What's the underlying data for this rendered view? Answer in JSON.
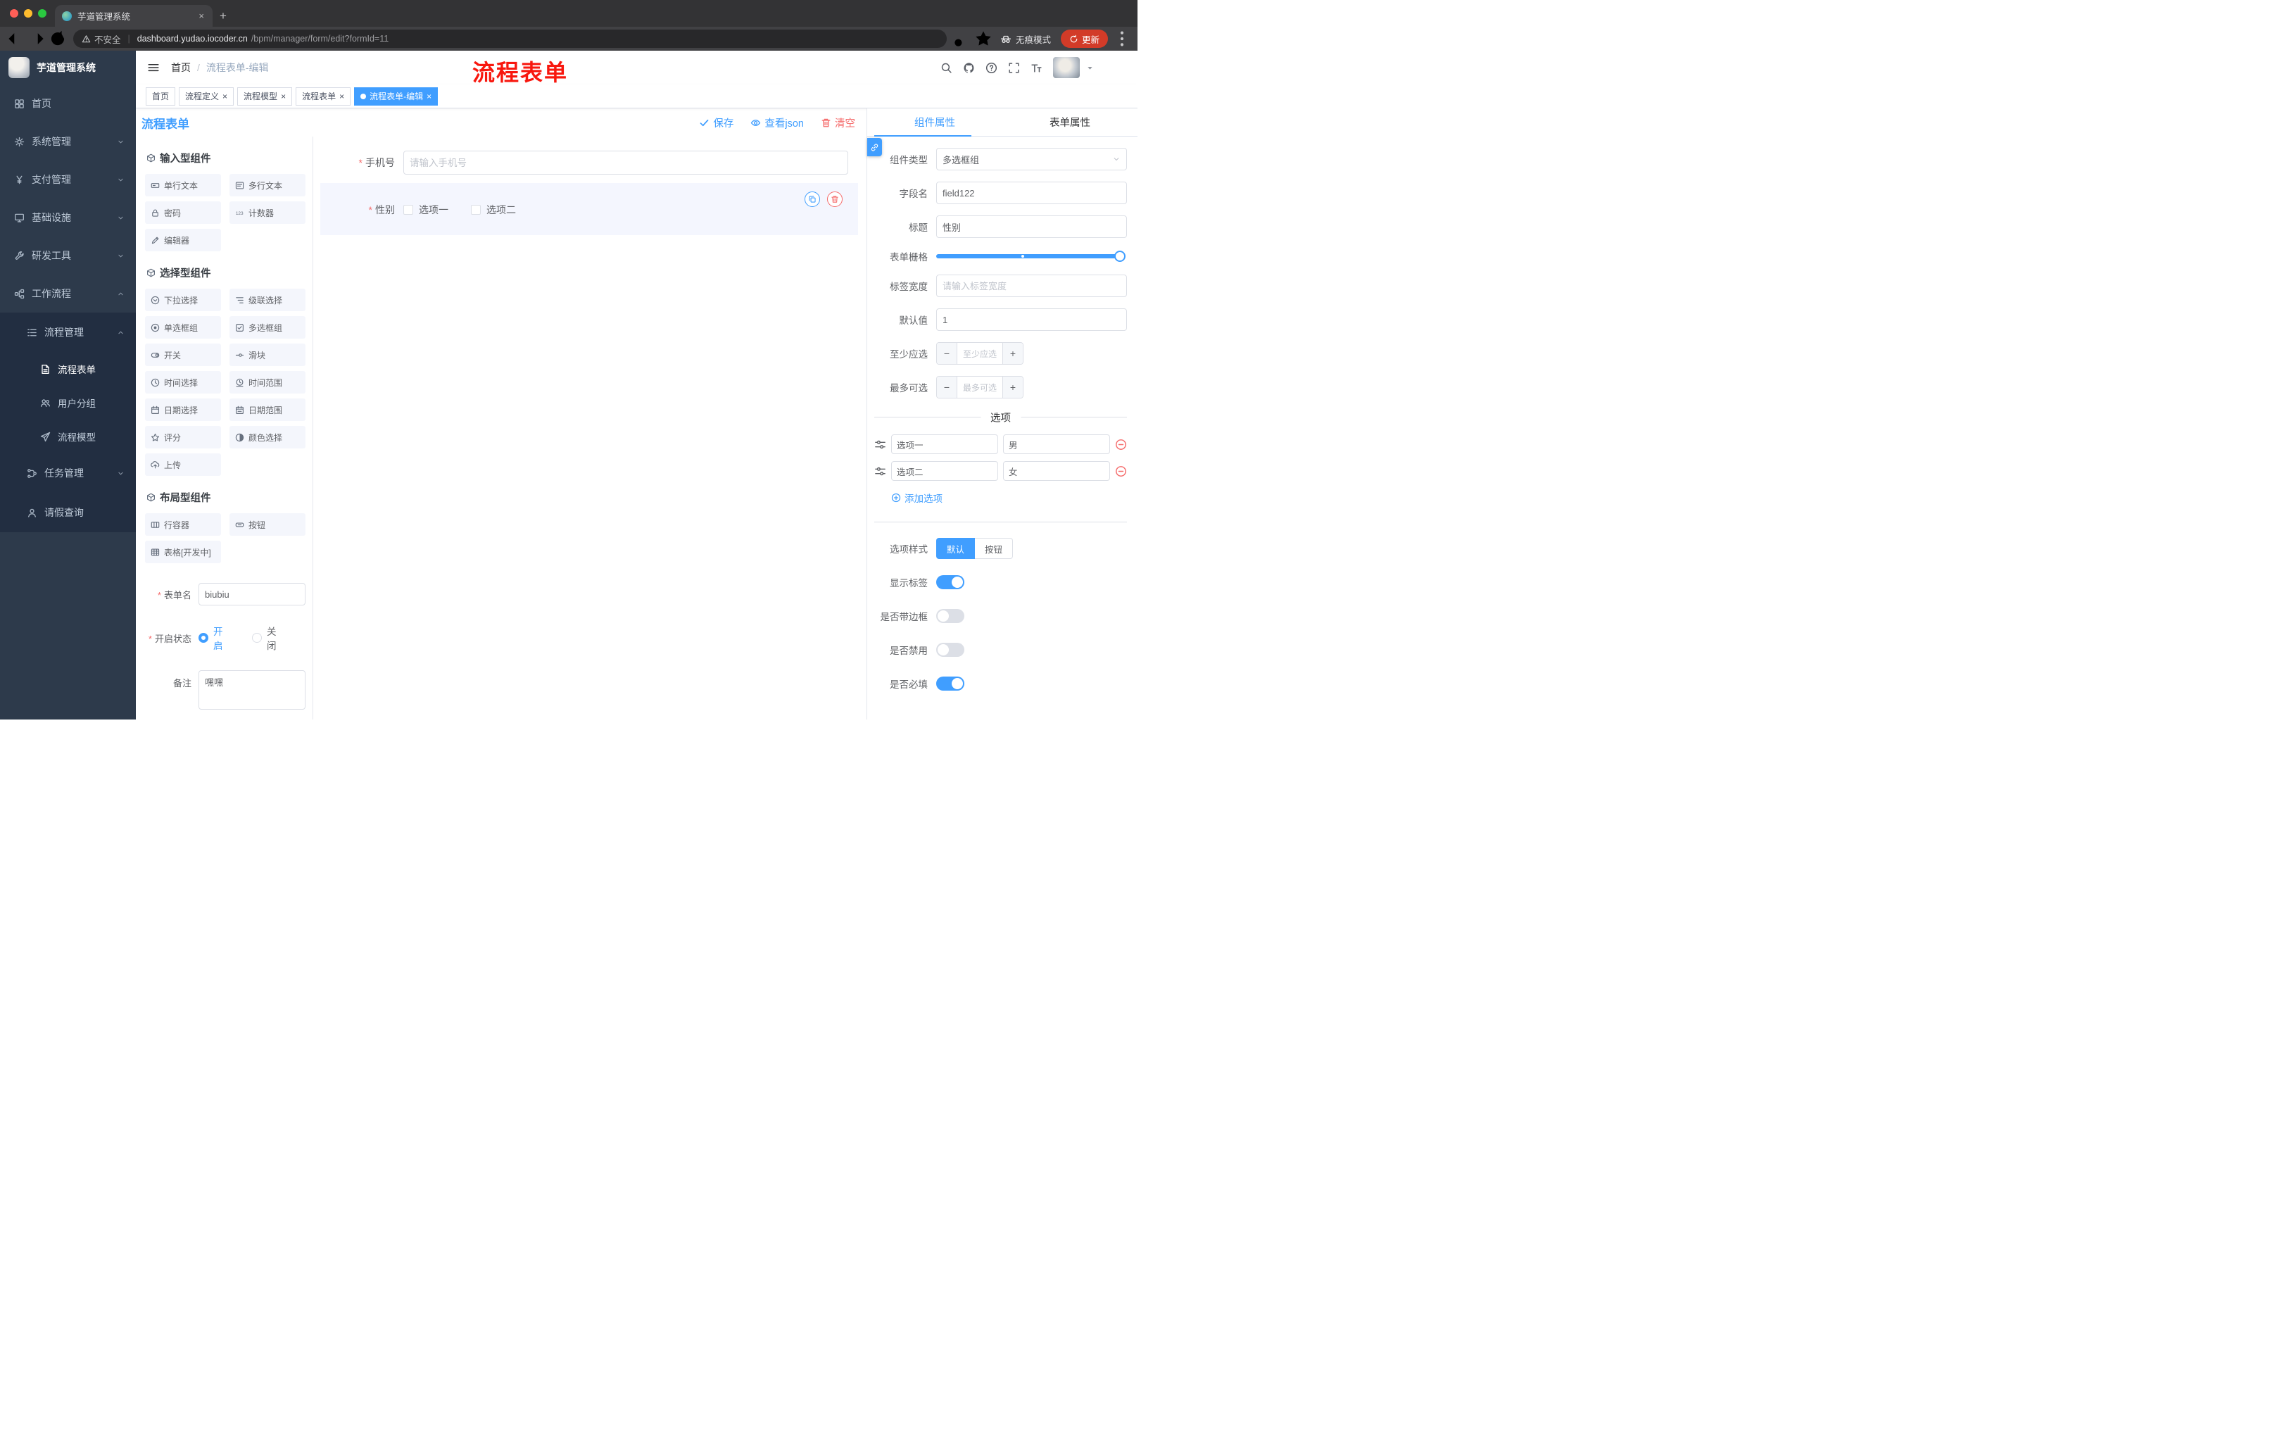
{
  "browser": {
    "tab_title": "芋道管理系统",
    "security_label": "不安全",
    "url_host": "dashboard.yudao.iocoder.cn",
    "url_path": "/bpm/manager/form/edit?formId=11",
    "incognito_label": "无痕模式",
    "update_label": "更新"
  },
  "sidebar": {
    "logo_title": "芋道管理系统",
    "items": [
      {
        "id": "home",
        "label": "首页",
        "icon": "dashboard",
        "level": 0
      },
      {
        "id": "system",
        "label": "系统管理",
        "icon": "gear",
        "level": 0,
        "chevron": "down"
      },
      {
        "id": "payment",
        "label": "支付管理",
        "icon": "yen",
        "level": 0,
        "chevron": "down"
      },
      {
        "id": "infra",
        "label": "基础设施",
        "icon": "monitor",
        "level": 0,
        "chevron": "down"
      },
      {
        "id": "devtools",
        "label": "研发工具",
        "icon": "wrench",
        "level": 0,
        "chevron": "down"
      },
      {
        "id": "workflow",
        "label": "工作流程",
        "icon": "workflow",
        "level": 0,
        "chevron": "up"
      },
      {
        "id": "process-management",
        "label": "流程管理",
        "icon": "list",
        "level": 1,
        "chevron": "up",
        "submenu": true
      },
      {
        "id": "process-form",
        "label": "流程表单",
        "icon": "form",
        "level": 2,
        "submenu": true,
        "active": true
      },
      {
        "id": "user-group",
        "label": "用户分组",
        "icon": "users",
        "level": 2,
        "submenu": true
      },
      {
        "id": "process-model",
        "label": "流程模型",
        "icon": "send",
        "level": 2,
        "submenu": true
      },
      {
        "id": "task-management",
        "label": "任务管理",
        "icon": "tasks",
        "level": 1,
        "chevron": "down",
        "submenu": true
      },
      {
        "id": "leave-query",
        "label": "请假查询",
        "icon": "user",
        "level": 1,
        "submenu": true
      }
    ]
  },
  "header": {
    "breadcrumb_home": "首页",
    "breadcrumb_current": "流程表单-编辑",
    "annotation": "流程表单"
  },
  "tabs_bar": [
    {
      "id": "home",
      "label": "首页"
    },
    {
      "id": "process-definition",
      "label": "流程定义",
      "closable": true
    },
    {
      "id": "process-model",
      "label": "流程模型",
      "closable": true
    },
    {
      "id": "process-form",
      "label": "流程表单",
      "closable": true
    },
    {
      "id": "process-form-edit",
      "label": "流程表单-编辑",
      "closable": true,
      "active": true
    }
  ],
  "board": {
    "title": "流程表单",
    "save_label": "保存",
    "view_json_label": "查看json",
    "clear_label": "清空"
  },
  "palette": {
    "sections": [
      {
        "id": "input",
        "title": "输入型组件",
        "items": [
          {
            "id": "text",
            "label": "单行文本",
            "icon": "text-field"
          },
          {
            "id": "textarea",
            "label": "多行文本",
            "icon": "textarea"
          },
          {
            "id": "password",
            "label": "密码",
            "icon": "lock"
          },
          {
            "id": "counter",
            "label": "计数器",
            "icon": "counter"
          },
          {
            "id": "editor",
            "label": "编辑器",
            "icon": "editor"
          }
        ]
      },
      {
        "id": "select",
        "title": "选择型组件",
        "items": [
          {
            "id": "select",
            "label": "下拉选择",
            "icon": "select"
          },
          {
            "id": "cascader",
            "label": "级联选择",
            "icon": "cascader"
          },
          {
            "id": "radio-group",
            "label": "单选框组",
            "icon": "radio"
          },
          {
            "id": "checkbox-group",
            "label": "多选框组",
            "icon": "checkbox"
          },
          {
            "id": "switch",
            "label": "开关",
            "icon": "switch"
          },
          {
            "id": "slider",
            "label": "滑块",
            "icon": "slider"
          },
          {
            "id": "time",
            "label": "时间选择",
            "icon": "time"
          },
          {
            "id": "time-range",
            "label": "时间范围",
            "icon": "time-range"
          },
          {
            "id": "date",
            "label": "日期选择",
            "icon": "date"
          },
          {
            "id": "date-range",
            "label": "日期范围",
            "icon": "date-range"
          },
          {
            "id": "rate",
            "label": "评分",
            "icon": "star"
          },
          {
            "id": "color",
            "label": "颜色选择",
            "icon": "color"
          },
          {
            "id": "upload",
            "label": "上传",
            "icon": "upload"
          }
        ]
      },
      {
        "id": "layout",
        "title": "布局型组件",
        "items": [
          {
            "id": "row",
            "label": "行容器",
            "icon": "row"
          },
          {
            "id": "button",
            "label": "按钮",
            "icon": "button"
          },
          {
            "id": "table",
            "label": "表格[开发中]",
            "icon": "table"
          }
        ]
      }
    ],
    "form": {
      "name_label": "表单名",
      "name_value": "biubiu",
      "status_label": "开启状态",
      "status_on": "开启",
      "status_off": "关闭",
      "status_selected": "开启",
      "remark_label": "备注",
      "remark_value": "嘿嘿"
    }
  },
  "canvas": {
    "fields": [
      {
        "label": "手机号",
        "required": true,
        "type": "input",
        "placeholder": "请输入手机号"
      },
      {
        "label": "性别",
        "required": true,
        "type": "checkbox-group",
        "options": [
          "选项一",
          "选项二"
        ],
        "selected": true
      }
    ]
  },
  "right_panel": {
    "tabs": [
      "组件属性",
      "表单属性"
    ],
    "active_tab": "组件属性",
    "fields": {
      "component_type_label": "组件类型",
      "component_type_value": "多选框组",
      "field_name_label": "字段名",
      "field_name_value": "field122",
      "title_label": "标题",
      "title_value": "性别",
      "grid_label": "表单栅格",
      "label_width_label": "标签宽度",
      "label_width_placeholder": "请输入标签宽度",
      "default_label": "默认值",
      "default_value": "1",
      "min_label": "至少应选",
      "min_placeholder": "至少应选",
      "max_label": "最多可选",
      "max_placeholder": "最多可选"
    },
    "options": {
      "divider": "选项",
      "rows": [
        {
          "name": "选项一",
          "value": "男"
        },
        {
          "name": "选项二",
          "value": "女"
        }
      ],
      "add_label": "添加选项"
    },
    "style": {
      "label": "选项样式",
      "options": [
        "默认",
        "按钮"
      ],
      "active": "默认"
    },
    "switches": [
      {
        "id": "show-label",
        "label": "显示标签",
        "on": true
      },
      {
        "id": "border",
        "label": "是否带边框",
        "on": false
      },
      {
        "id": "disabled",
        "label": "是否禁用",
        "on": false
      },
      {
        "id": "required",
        "label": "是否必填",
        "on": true
      }
    ]
  },
  "colors": {
    "primary": "#409EFF",
    "danger": "#F56C6C",
    "sidebar_bg": "#2d3a4b",
    "submenu_bg": "#222e41"
  }
}
